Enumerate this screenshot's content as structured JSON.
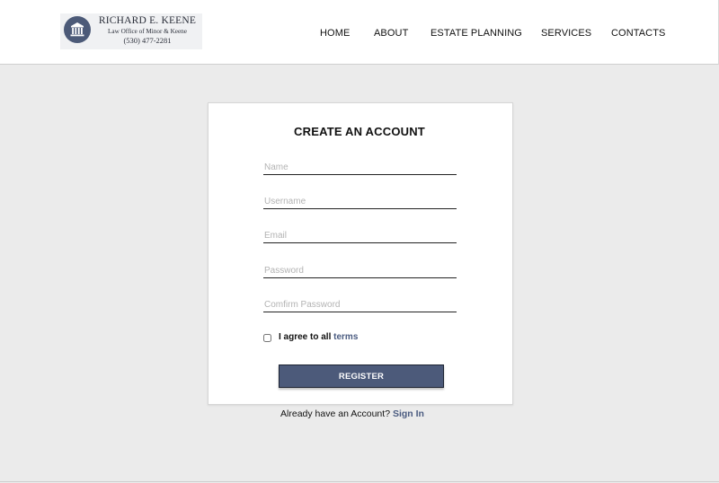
{
  "logo": {
    "name": "RICHARD E. KEENE",
    "subtitle": "Law Office of Minor & Keene",
    "phone": "(530) 477-2281",
    "emblem_icon": "courthouse-icon"
  },
  "nav": {
    "items": [
      {
        "label": "HOME"
      },
      {
        "label": "ABOUT"
      },
      {
        "label": "ESTATE PLANNING"
      },
      {
        "label": "SERVICES"
      },
      {
        "label": "CONTACTS"
      }
    ]
  },
  "form": {
    "title": "CREATE AN ACCOUNT",
    "fields": [
      {
        "placeholder": "Name",
        "value": ""
      },
      {
        "placeholder": "Username",
        "value": ""
      },
      {
        "placeholder": "Email",
        "value": ""
      },
      {
        "placeholder": "Password",
        "value": ""
      },
      {
        "placeholder": "Comfirm Password",
        "value": ""
      }
    ],
    "agree_prefix": "I agree to all",
    "agree_link": "terms",
    "agree_checked": false,
    "register_label": "REGISTER"
  },
  "signin": {
    "prompt": "Already have an Account?",
    "link": "Sign In"
  },
  "colors": {
    "accent": "#4c5a7a",
    "link": "#4a5b80",
    "page_background": "#ebebeb"
  }
}
